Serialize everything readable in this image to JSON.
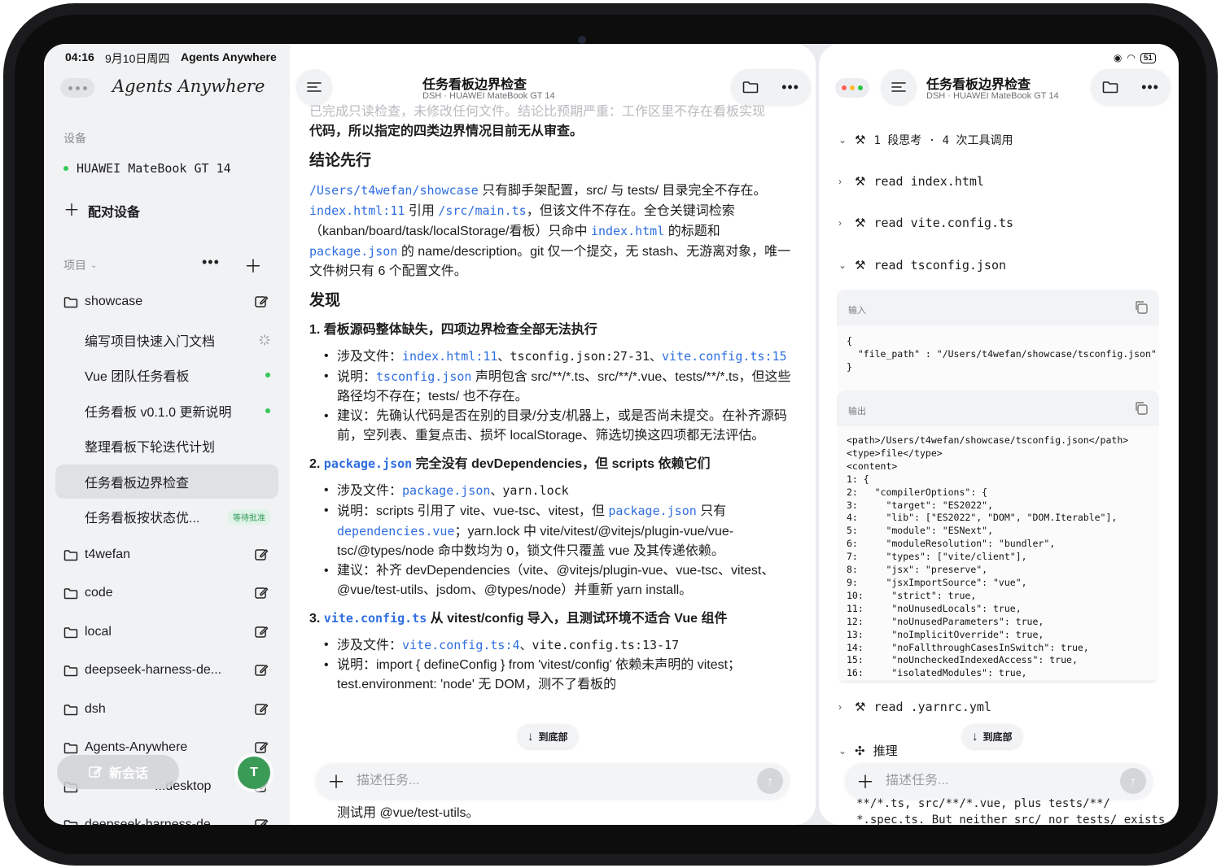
{
  "status_bar": {
    "time": "04:16",
    "date": "9月10日周四",
    "app": "Agents Anywhere",
    "battery": "51"
  },
  "sidebar": {
    "brand": "Agents Anywhere",
    "devices_label": "设备",
    "device_name": "HUAWEI MateBook GT 14",
    "pair_label": "配对设备",
    "projects_label": "项目",
    "projects": [
      {
        "name": "showcase"
      },
      {
        "name": "t4wefan"
      },
      {
        "name": "code"
      },
      {
        "name": "local"
      },
      {
        "name": "deepseek-harness-de..."
      },
      {
        "name": "dsh"
      },
      {
        "name": "Agents-Anywhere"
      },
      {
        "name": "...desktop"
      },
      {
        "name": "deepseek-harness-de..."
      }
    ],
    "tasks": [
      {
        "title": "编写项目快速入门文档",
        "state": "running"
      },
      {
        "title": "Vue 团队任务看板",
        "state": "done"
      },
      {
        "title": "任务看板 v0.1.0 更新说明",
        "state": "done"
      },
      {
        "title": "整理看板下轮迭代计划",
        "state": ""
      },
      {
        "title": "任务看板边界检查",
        "state": "active"
      },
      {
        "title": "任务看板按状态优...",
        "badge": "等待批准"
      }
    ],
    "new_session_label": "新会话",
    "avatar_initial": "T"
  },
  "left_pane": {
    "title": "任务看板边界检查",
    "subtitle": "DSH · HUAWEI MateBook GT 14",
    "faded_line": "已完成只读检查，未修改任何文件。结论比预期严重：工作区里不存在看板实现",
    "intro_tail": "代码，所以指定的四类边界情况目前无从审查。",
    "h_conclusion": "结论先行",
    "conclusion": {
      "path": "/Users/t4wefan/showcase",
      "t1": " 只有脚手架配置，src/ 与 tests/ 目录完全不存在。",
      "link_index": "index.html:11",
      "t2": " 引用 ",
      "link_main": "/src/main.ts",
      "t3": "，但该文件不存在。全仓关键词检索（kanban/board/task/localStorage/看板）只命中 ",
      "link_index2": "index.html",
      "t4": " 的标题和 ",
      "link_pkg": "package.json",
      "t5": " 的 name/description。git 仅一个提交，无 stash、无游离对象，唯一文件树只有 6 个配置文件。"
    },
    "h_findings": "发现",
    "f1": {
      "title": "1. 看板源码整体缺失，四项边界检查全部无法执行",
      "files_prefix": "涉及文件：",
      "files_link": "index.html:11",
      "files_mid": "、tsconfig.json:27-31、",
      "files_link2": "vite.config.ts:15",
      "note_prefix": "说明：",
      "note_link": "tsconfig.json",
      "note_text": " 声明包含 src/**/*.ts、src/**/*.vue、tests/**/*.ts，但这些路径均不存在；tests/ 也不存在。",
      "suggest": "建议：先确认代码是否在别的目录/分支/机器上，或是否尚未提交。在补齐源码前，空列表、重复点击、损坏 localStorage、筛选切换这四项都无法评估。"
    },
    "f2": {
      "num": "2. ",
      "link": "package.json",
      "title_rest": " 完全没有 devDependencies，但 scripts 依赖它们",
      "files_prefix": "涉及文件：",
      "files_link": "package.json",
      "files_rest": "、yarn.lock",
      "note_a": "说明：scripts 引用了 vite、vue-tsc、vitest，但 ",
      "note_link": "package.json",
      "note_b": " 只有 ",
      "note_link2": "dependencies.vue",
      "note_c": "；yarn.lock 中 vite/vitest/@vitejs/plugin-vue/vue-tsc/@types/node 命中数均为 0，锁文件只覆盖 vue 及其传递依赖。",
      "suggest": "建议：补齐 devDependencies（vite、@vitejs/plugin-vue、vue-tsc、vitest、@vue/test-utils、jsdom、@types/node）并重新 yarn install。"
    },
    "f3": {
      "num": "3. ",
      "link": "vite.config.ts",
      "title_rest": " 从 vitest/config 导入，且测试环境不适合 Vue 组件",
      "files_prefix": "涉及文件：",
      "files_link": "vite.config.ts:4",
      "files_rest": "、vite.config.ts:13-17",
      "note": "说明：import { defineConfig } from 'vitest/config' 依赖未声明的 vitest；test.environment: 'node' 无 DOM，测不了看板的",
      "tail": "测试用 @vue/test-utils。"
    },
    "jump_label": "到底部",
    "input_placeholder": "描述任务..."
  },
  "right_pane": {
    "title": "任务看板边界检查",
    "subtitle": "DSH · HUAWEI MateBook GT 14",
    "summary": "1 段思考 · 4 次工具调用",
    "tools": [
      "read index.html",
      "read vite.config.ts",
      "read tsconfig.json",
      "read .yarnrc.yml"
    ],
    "input_label": "输入",
    "output_label": "输出",
    "input_code": "{\n  \"file_path\" : \"/Users/t4wefan/showcase/tsconfig.json\"\n}",
    "output_code": "<path>/Users/t4wefan/showcase/tsconfig.json</path>\n<type>file</type>\n<content>\n1: {\n2:   \"compilerOptions\": {\n3:     \"target\": \"ES2022\",\n4:     \"lib\": [\"ES2022\", \"DOM\", \"DOM.Iterable\"],\n5:     \"module\": \"ESNext\",\n6:     \"moduleResolution\": \"bundler\",\n7:     \"types\": [\"vite/client\"],\n8:     \"jsx\": \"preserve\",\n9:     \"jsxImportSource\": \"vue\",\n10:     \"strict\": true,\n11:     \"noUnusedLocals\": true,\n12:     \"noUnusedParameters\": true,\n13:     \"noImplicitOverride\": true,\n14:     \"noFallthroughCasesInSwitch\": true,\n15:     \"noUncheckedIndexedAccess\": true,\n16:     \"isolatedModules\": true,",
    "reasoning_label": "推理",
    "jump_label": "到底部",
    "input_placeholder": "描述任务...",
    "bottom_text_1": "**/*.ts, src/**/*.vue, plus tests/**/",
    "bottom_text_2": "*.spec.ts. But neither src/ nor tests/ exists"
  },
  "colors": {
    "accent_link": "#2f6ee0",
    "online_green": "#34c759",
    "badge_green": "#2e9a5a",
    "avatar_green": "#3a9b57",
    "traffic_red": "#ff5f57",
    "traffic_yellow": "#febc2e",
    "traffic_green": "#28c840"
  }
}
